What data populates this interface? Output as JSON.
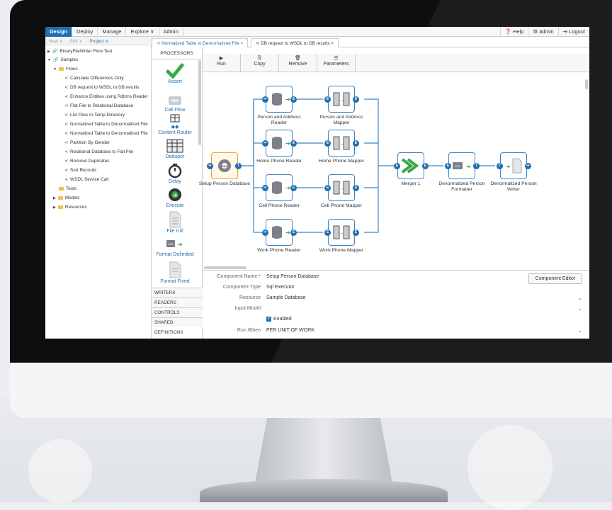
{
  "nav": {
    "design": "Design",
    "deploy": "Deploy",
    "manage": "Manage",
    "explore": "Explore ∨",
    "admin": "Admin",
    "help": "Help",
    "user": "admin",
    "logout": "Logout"
  },
  "subnav": {
    "new": "New ∨",
    "edit": "Edit ∨",
    "project": "Project ∨"
  },
  "tree": {
    "items": [
      "BinaryFileWriter Flow Test",
      "Samples",
      "Flows",
      "Calculate Differences Only",
      "DB request to WSDL to DB results",
      "Enhance Entities using Rdbms Reader",
      "Flat File to Relational Database",
      "List Files In Temp Directory",
      "Normalized Table to Denormalized File",
      "Normalized Table to Denormalized File",
      "Partition By Gender",
      "Relational Database to Flat File",
      "Remove Duplicates",
      "Sort Records",
      "WSDL Service Call",
      "Tests",
      "Models",
      "Resources"
    ]
  },
  "tabs": [
    {
      "label": "Normalized Table to Denormalized File"
    },
    {
      "label": "DB request to WSDL to DB results"
    }
  ],
  "palette": {
    "header": "PROCESSORS",
    "items": [
      "Assert",
      "Call Flow",
      "Content Router",
      "Deduper",
      "Delay",
      "Execute",
      "File Util",
      "Format Delimited",
      "Format Fixed"
    ],
    "sections": [
      "WRITERS",
      "READERS",
      "CONTROLS",
      "SHARED DEFINITIONS"
    ]
  },
  "toolbar": {
    "run": "Run",
    "copy": "Copy",
    "remove": "Remove",
    "parameters": "Parameters"
  },
  "canvas": {
    "nodes": [
      "Setup Person Database",
      "Person and Address Reader",
      "Person and Address Mapper",
      "Home Phone Reader",
      "Home Phone Mapper",
      "Cell Phone Reader",
      "Cell Phone Mapper",
      "Work Phone Reader",
      "Work Phone Mapper",
      "Merger 1",
      "Denormalized Person Formatter",
      "Denormalized Person Writer"
    ]
  },
  "properties": {
    "name_label": "Component Name:",
    "name_required": "*",
    "name_value": "Setup Person Database",
    "type_label": "Component Type",
    "type_value": "Sql Executor",
    "resource_label": "Resource",
    "resource_value": "Sample Database",
    "input_label": "Input Model",
    "input_value": "",
    "enabled_label": "Enabled",
    "runwhen_label": "Run When",
    "runwhen_value": "PER UNIT OF WORK",
    "editor_button": "Component Editor"
  },
  "colors": {
    "accent": "#1f6fb2",
    "selected": "#e9a43a",
    "green": "#3aa845"
  }
}
